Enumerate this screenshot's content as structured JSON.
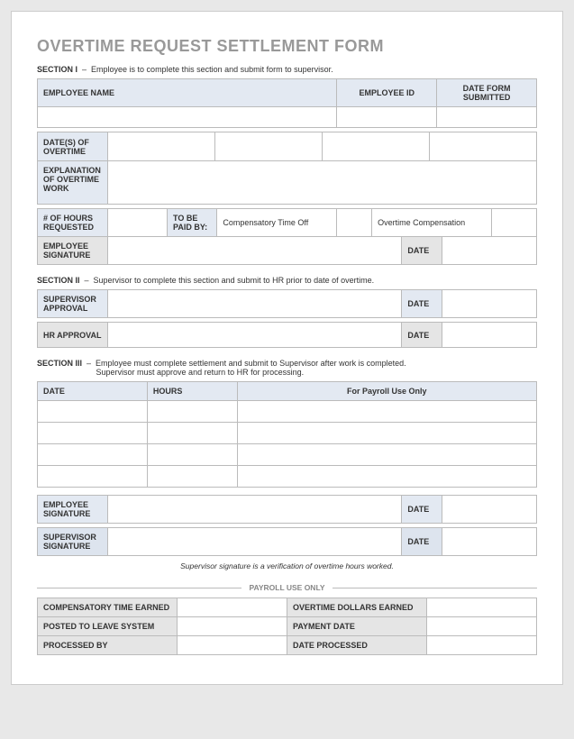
{
  "title": "OVERTIME REQUEST SETTLEMENT FORM",
  "section1": {
    "label": "SECTION I",
    "desc": "Employee is to complete this section and submit form to supervisor.",
    "emp_name": "EMPLOYEE NAME",
    "emp_id": "EMPLOYEE ID",
    "date_submitted": "DATE FORM SUBMITTED",
    "dates_ot": "DATE(S) OF OVERTIME",
    "explanation": "EXPLANATION OF OVERTIME WORK",
    "hours_req": "# OF HOURS REQUESTED",
    "paid_by": "TO BE PAID BY:",
    "comp_time": "Compensatory Time Off",
    "ot_comp": "Overtime Compensation",
    "emp_sig": "EMPLOYEE SIGNATURE",
    "date": "DATE"
  },
  "section2": {
    "label": "SECTION II",
    "desc": "Supervisor to complete this section and submit to HR prior to date of overtime.",
    "sup_approval": "SUPERVISOR APPROVAL",
    "hr_approval": "HR APPROVAL",
    "date": "DATE"
  },
  "section3": {
    "label": "SECTION III",
    "desc1": "Employee must complete settlement and submit to Supervisor after work is completed.",
    "desc2": "Supervisor must approve and return to HR for processing.",
    "col_date": "DATE",
    "col_hours": "HOURS",
    "col_payroll": "For Payroll Use Only",
    "emp_sig": "EMPLOYEE SIGNATURE",
    "sup_sig": "SUPERVISOR SIGNATURE",
    "date": "DATE",
    "note": "Supervisor signature is a verification of overtime hours worked."
  },
  "payroll": {
    "header": "PAYROLL USE ONLY",
    "comp_earned": "COMPENSATORY TIME EARNED",
    "ot_dollars": "OVERTIME DOLLARS EARNED",
    "posted": "POSTED TO LEAVE SYSTEM",
    "pay_date": "PAYMENT DATE",
    "processed_by": "PROCESSED BY",
    "date_processed": "DATE PROCESSED"
  }
}
